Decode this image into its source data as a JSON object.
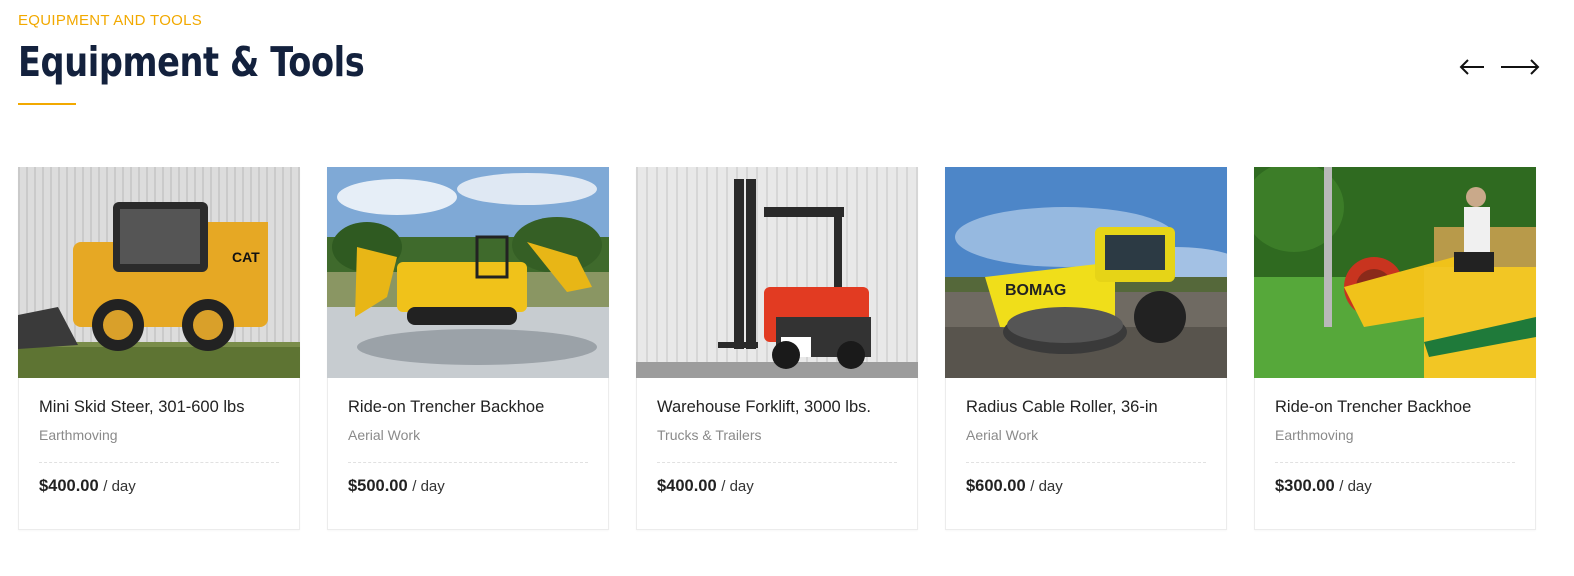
{
  "section": {
    "eyebrow": "EQUIPMENT AND TOOLS",
    "title": "Equipment & Tools",
    "accent_color": "#f2a900",
    "title_color": "#13213d"
  },
  "nav": {
    "prev_icon": "arrow-left-icon",
    "next_icon": "arrow-right-icon"
  },
  "cards": [
    {
      "image": "skid-steer-photo",
      "title": "Mini Skid Steer, 301-600 lbs",
      "category": "Earthmoving",
      "price": "$400.00",
      "unit": "/ day"
    },
    {
      "image": "trencher-backhoe-photo",
      "title": "Ride-on Trencher Backhoe",
      "category": "Aerial Work",
      "price": "$500.00",
      "unit": "/ day"
    },
    {
      "image": "forklift-photo",
      "title": "Warehouse Forklift, 3000 lbs.",
      "category": "Trucks & Trailers",
      "price": "$400.00",
      "unit": "/ day"
    },
    {
      "image": "cable-roller-photo",
      "title": "Radius Cable Roller, 36-in",
      "category": "Aerial Work",
      "price": "$600.00",
      "unit": "/ day"
    },
    {
      "image": "trencher-backhoe-field-photo",
      "title": "Ride-on Trencher Backhoe",
      "category": "Earthmoving",
      "price": "$300.00",
      "unit": "/ day"
    }
  ]
}
